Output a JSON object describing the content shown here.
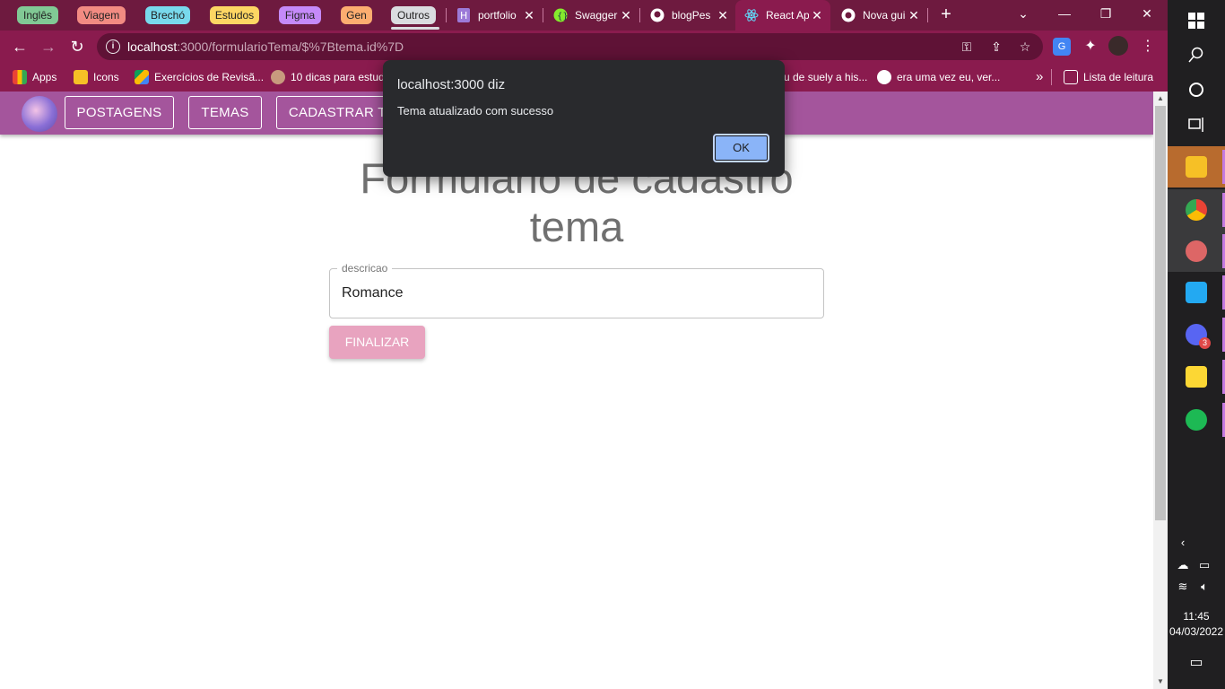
{
  "tab_groups": [
    {
      "label": "Inglês",
      "color": "#81c995"
    },
    {
      "label": "Viagem",
      "color": "#f28b82"
    },
    {
      "label": "Brechó",
      "color": "#78d9ec"
    },
    {
      "label": "Estudos",
      "color": "#fdd663"
    },
    {
      "label": "Figma",
      "color": "#c58af9"
    },
    {
      "label": "Gen",
      "color": "#fcad70"
    },
    {
      "label": "Outros",
      "color": "#dadce0"
    }
  ],
  "tabs": [
    {
      "title": "portfolio",
      "icon": "heroku-icon"
    },
    {
      "title": "Swagger",
      "icon": "swagger-icon"
    },
    {
      "title": "blogPes",
      "icon": "github-icon"
    },
    {
      "title": "React App",
      "icon": "react-icon",
      "active": true
    },
    {
      "title": "Nova guia",
      "icon": "chrome-icon"
    }
  ],
  "address": {
    "host": "localhost",
    "path": ":3000/formularioTema/$%7Btema.id%7D"
  },
  "bookmarks": [
    {
      "label": "Apps",
      "icon": "apps-grid-icon"
    },
    {
      "label": "Icons",
      "icon": "folder-icon"
    },
    {
      "label": "Exercícios de Revisã...",
      "icon": "google-drive-icon"
    },
    {
      "label": "10 dicas para estud",
      "icon": "avatar-icon"
    },
    {
      "label": "u de suely a his...",
      "icon": "none"
    },
    {
      "label": "era uma vez eu, ver...",
      "icon": "google-icon"
    }
  ],
  "bookmarks_overflow": "»",
  "reading_list": "Lista de leitura",
  "app_nav": {
    "links": [
      "POSTAGENS",
      "TEMAS",
      "CADASTRAR TEMA"
    ]
  },
  "form": {
    "title": "Formulario de cadastro tema",
    "field_label": "descricao",
    "field_value": "Romance",
    "submit_label": "FINALIZAR"
  },
  "dialog": {
    "title": "localhost:3000 diz",
    "message": "Tema atualizado com sucesso",
    "ok_label": "OK"
  },
  "taskbar": {
    "time": "11:45",
    "date": "04/03/2022",
    "discord_badge": "3"
  }
}
